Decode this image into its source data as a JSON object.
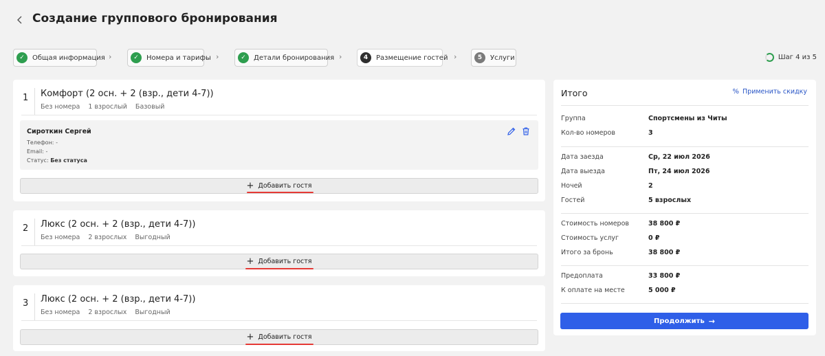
{
  "header": {
    "back_icon": "←",
    "title": "Создание группового бронирования"
  },
  "stepper": {
    "steps": [
      {
        "label": "Общая информация",
        "state": "done",
        "marker": "✓"
      },
      {
        "label": "Номера и тарифы",
        "state": "done",
        "marker": "✓"
      },
      {
        "label": "Детали бронирования",
        "state": "done",
        "marker": "✓"
      },
      {
        "label": "Размещение гостей",
        "state": "current",
        "marker": "4"
      },
      {
        "label": "Услуги",
        "state": "todo",
        "marker": "5"
      }
    ],
    "chevron": "›",
    "progress_text": "Шаг 4 из 5"
  },
  "rooms": [
    {
      "number": "1",
      "title": "Комфорт (2 осн. + 2 (взр., дети 4-7))",
      "room_no": "Без номера",
      "guests": "1 взрослый",
      "rate": "Базовый",
      "guest_card": {
        "name": "Сироткин Сергей",
        "phone_label": "Телефон:",
        "phone_value": "-",
        "email_label": "Email:",
        "email_value": "-",
        "status_label": "Статус:",
        "status_value": "Без статуса"
      },
      "add_label": "Добавить гостя"
    },
    {
      "number": "2",
      "title": "Люкс (2 осн. + 2 (взр., дети 4-7))",
      "room_no": "Без номера",
      "guests": "2 взрослых",
      "rate": "Выгодный",
      "add_label": "Добавить гостя"
    },
    {
      "number": "3",
      "title": "Люкс (2 осн. + 2 (взр., дети 4-7))",
      "room_no": "Без номера",
      "guests": "2 взрослых",
      "rate": "Выгодный",
      "add_label": "Добавить гостя"
    }
  ],
  "summary": {
    "title": "Итого",
    "discount_label": "Применить скидку",
    "rows": {
      "group_label": "Группа",
      "group_value": "Спортсмены из Читы",
      "rooms_count_label": "Кол-во номеров",
      "rooms_count_value": "3",
      "checkin_label": "Дата заезда",
      "checkin_value": "Ср, 22 июл 2026",
      "checkout_label": "Дата выезда",
      "checkout_value": "Пт, 24 июл 2026",
      "nights_label": "Ночей",
      "nights_value": "2",
      "guests_label": "Гостей",
      "guests_value": "5 взрослых",
      "rooms_cost_label": "Стоимость номеров",
      "rooms_cost_value": "38 800 ₽",
      "services_cost_label": "Стоимость услуг",
      "services_cost_value": "0 ₽",
      "total_label": "Итого за бронь",
      "total_value": "38 800 ₽",
      "prepay_label": "Предоплата",
      "prepay_value": "33 800 ₽",
      "onsite_label": "К оплате на месте",
      "onsite_value": "5 000 ₽"
    },
    "continue_label": "Продолжить"
  },
  "colors": {
    "accent": "#2f5fe8",
    "done": "#2e9e4f",
    "highlight": "#e53935"
  }
}
